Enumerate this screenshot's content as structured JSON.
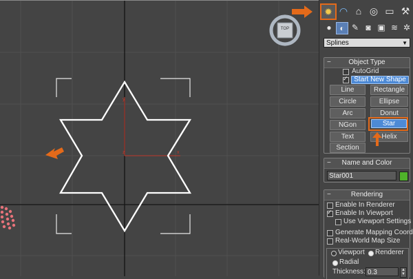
{
  "viewport": {
    "navcube_label": "TOP",
    "axis_labels": {
      "y": "y",
      "x": "x",
      "origin": "z"
    }
  },
  "colors": {
    "accent_orange": "#e46a1a",
    "star_stroke": "#ffffff",
    "axis_red": "#c0392b",
    "grid": "#505050",
    "object_color": "#4fb22a",
    "active_button": "#4d8ad6"
  },
  "command_panel": {
    "tabs": [
      {
        "icon": "create-icon",
        "glyph": "✹"
      },
      {
        "icon": "modify-icon",
        "glyph": "◠"
      },
      {
        "icon": "hierarchy-icon",
        "glyph": "⌂"
      },
      {
        "icon": "motion-icon",
        "glyph": "◎"
      },
      {
        "icon": "display-icon",
        "glyph": "▭"
      },
      {
        "icon": "utilities-icon",
        "glyph": "⚒"
      }
    ],
    "subicons": [
      {
        "icon": "geometry-icon",
        "glyph": "●"
      },
      {
        "icon": "shapes-icon",
        "glyph": "◐"
      },
      {
        "icon": "lights-icon",
        "glyph": "✎"
      },
      {
        "icon": "cameras-icon",
        "glyph": "◙"
      },
      {
        "icon": "helpers-icon",
        "glyph": "▣"
      },
      {
        "icon": "spacewarps-icon",
        "glyph": "≋"
      },
      {
        "icon": "systems-icon",
        "glyph": "✲"
      }
    ],
    "category_dropdown": "Splines",
    "object_type": {
      "title": "Object Type",
      "autogrid_label": "AutoGrid",
      "start_new_shape_label": "Start New Shape",
      "buttons": [
        "Line",
        "Rectangle",
        "Circle",
        "Ellipse",
        "Arc",
        "Donut",
        "NGon",
        "Star",
        "Text",
        "Helix",
        "Section"
      ],
      "active_button": "Star"
    },
    "name_and_color": {
      "title": "Name and Color",
      "name_value": "Star001"
    },
    "rendering": {
      "title": "Rendering",
      "enable_in_renderer": "Enable In Renderer",
      "enable_in_viewport": "Enable In Viewport",
      "use_viewport_settings": "Use Viewport Settings",
      "generate_mapping": "Generate Mapping Coords.",
      "real_world_map": "Real-World Map Size",
      "viewport_radio": "Viewport",
      "renderer_radio": "Renderer",
      "radial_label": "Radial",
      "thickness_label": "Thickness:",
      "thickness_value": "0.3"
    }
  }
}
